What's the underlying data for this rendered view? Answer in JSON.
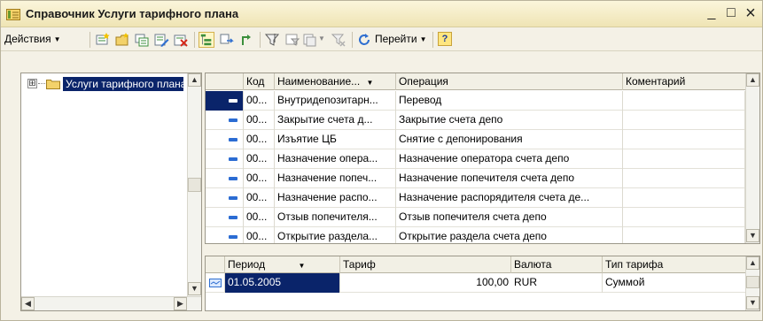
{
  "window": {
    "title": "Справочник Услуги тарифного плана",
    "minimize": "_",
    "maximize": "□",
    "close": "×"
  },
  "toolbar": {
    "actions_label": "Действия",
    "goto_label": "Перейти",
    "help_label": "?"
  },
  "tree": {
    "root_label": "Услуги тарифного плана",
    "expander": "⊞"
  },
  "services": {
    "columns": {
      "code": "Код",
      "name": "Наименование...",
      "operation": "Операция",
      "comment": "Коментарий"
    },
    "rows": [
      {
        "code": "00...",
        "name": "Внутридепозитарн...",
        "operation": "Перевод",
        "comment": ""
      },
      {
        "code": "00...",
        "name": "Закрытие счета д...",
        "operation": "Закрытие счета депо",
        "comment": ""
      },
      {
        "code": "00...",
        "name": "Изъятие ЦБ",
        "operation": "Снятие с депонирования",
        "comment": ""
      },
      {
        "code": "00...",
        "name": "Назначение опера...",
        "operation": "Назначение оператора счета депо",
        "comment": ""
      },
      {
        "code": "00...",
        "name": "Назначение попеч...",
        "operation": "Назначение попечителя счета депо",
        "comment": ""
      },
      {
        "code": "00...",
        "name": "Назначение распо...",
        "operation": "Назначение распорядителя счета де...",
        "comment": ""
      },
      {
        "code": "00...",
        "name": "Отзыв попечителя...",
        "operation": "Отзыв попечителя счета депо",
        "comment": ""
      },
      {
        "code": "00...",
        "name": "Открытие раздела...",
        "operation": "Открытие раздела счета депо",
        "comment": ""
      }
    ]
  },
  "tariffs": {
    "columns": {
      "period": "Период",
      "tariff": "Тариф",
      "currency": "Валюта",
      "type": "Тип тарифа"
    },
    "rows": [
      {
        "period": "01.05.2005",
        "tariff": "100,00",
        "currency": "RUR",
        "type": "Суммой"
      }
    ]
  }
}
